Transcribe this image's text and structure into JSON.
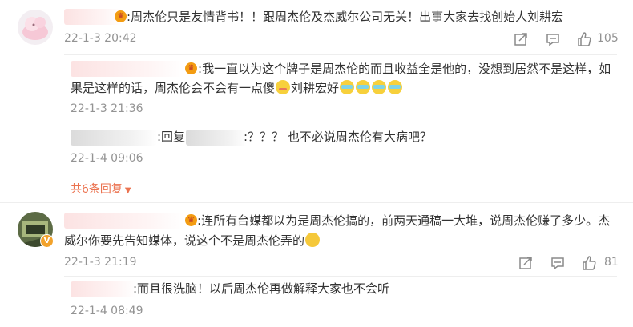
{
  "comments": [
    {
      "text_prefix": ":",
      "text": "周杰伦只是友情背书！！跟周杰伦及杰威尔公司无关！出事大家去找创始人刘耕宏",
      "time": "22-1-3 20:42",
      "likes": "105",
      "replies": [
        {
          "text_line1": "我一直以为这个牌子是周杰伦的而且收益全是他的，没想到居然不是这样，如",
          "text_line2": "果是这样的话，周杰伦会不会有一点傻",
          "text_line2_tail": "刘耕宏好",
          "time": "22-1-3 21:36"
        },
        {
          "text_reply_prefix": ":回复",
          "text": ":？？？ 也不必说周杰伦有大病吧？",
          "time": "22-1-4 09:06"
        }
      ],
      "more_replies": "共6条回复"
    },
    {
      "text_prefix": ":",
      "text_line1": "连所有台媒都以为是周杰伦搞的，前两天通稿一大堆，说周杰伦赚了多少。杰",
      "text_line2": "威尔你要先告知媒体，说这个不是周杰伦弄的",
      "time": "22-1-3 21:19",
      "likes": "81",
      "replies": [
        {
          "text": ":而且很洗脑！以后周杰伦再做解释大家也不会听",
          "time": "22-1-4 08:49"
        }
      ]
    }
  ],
  "colors": {
    "accent": "#eb7350",
    "time": "#939393",
    "text": "#333333"
  }
}
